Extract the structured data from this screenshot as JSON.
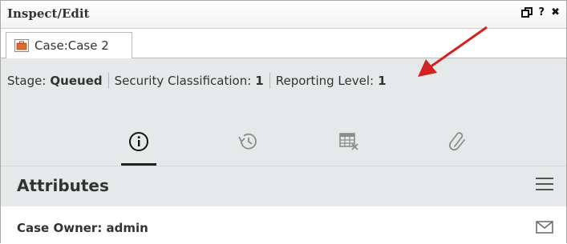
{
  "window": {
    "title": "Inspect/Edit",
    "controls": {
      "restore_icon": "restore-icon",
      "help_label": "?",
      "close_label": "✖"
    }
  },
  "tab": {
    "label": "Case:Case 2",
    "icon": "case-briefcase-icon",
    "icon_color": "#e06a2a"
  },
  "status": {
    "stage_label": "Stage:",
    "stage_value": "Queued",
    "security_label": "Security Classification:",
    "security_value": "1",
    "reporting_label": "Reporting Level:",
    "reporting_value": "1"
  },
  "annotation": {
    "arrow_color": "#d42121"
  },
  "icon_tabs": [
    {
      "name": "info-icon",
      "active": true
    },
    {
      "name": "history-icon",
      "active": false
    },
    {
      "name": "calendar-table-icon",
      "active": false
    },
    {
      "name": "paperclip-icon",
      "active": false
    }
  ],
  "attributes": {
    "title": "Attributes",
    "menu_icon": "hamburger-menu-icon",
    "case_owner": "Case Owner: admin",
    "mail_icon": "mail-icon"
  }
}
